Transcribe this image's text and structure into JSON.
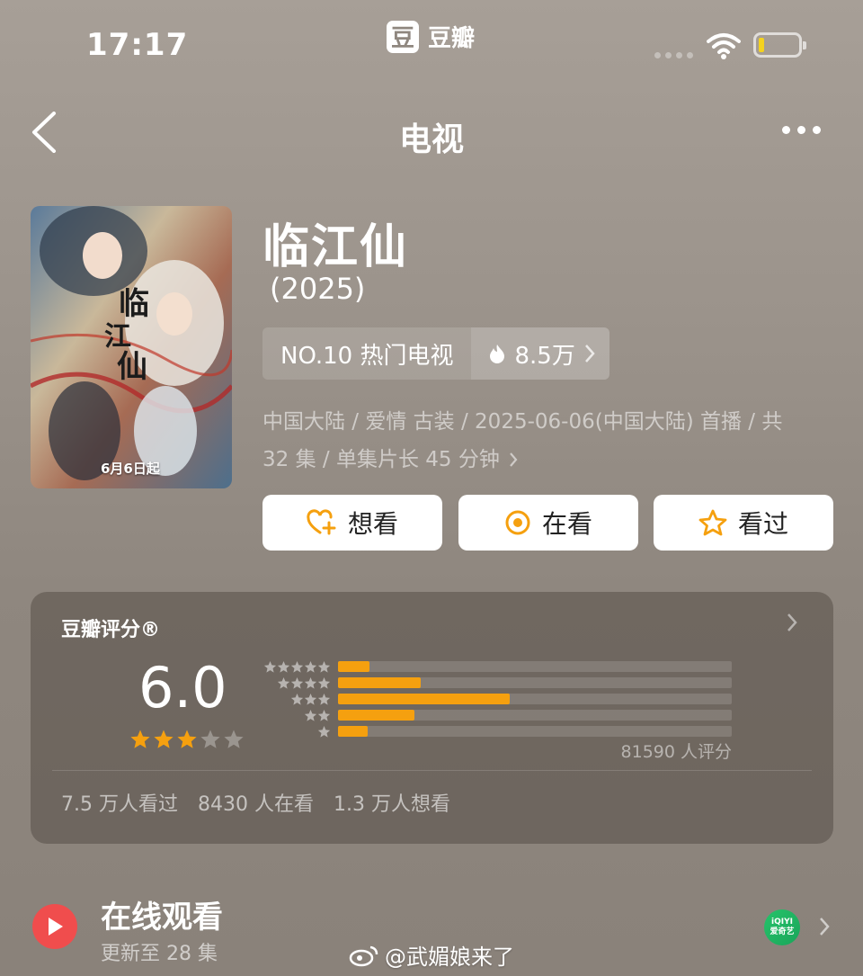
{
  "status_bar": {
    "time": "17:17",
    "brand_logo": "豆",
    "brand_name": "豆瓣"
  },
  "nav": {
    "title": "电视",
    "back_icon": "chevron-left-icon",
    "more_icon": "more-dots-icon"
  },
  "poster": {
    "label": "6月6日起"
  },
  "show": {
    "title": "临江仙",
    "year": "(2025)",
    "rank_label": "NO.10 热门电视",
    "heat": "8.5万",
    "meta_line1": "中国大陆 / 爱情 古装 / 2025-06-06(中国大陆) 首播 / 共",
    "meta_line2": "32 集 / 单集片长 45 分钟"
  },
  "actions": [
    {
      "label": "想看",
      "icon": "heart-plus-icon"
    },
    {
      "label": "在看",
      "icon": "watching-circle-icon"
    },
    {
      "label": "看过",
      "icon": "star-outline-icon"
    }
  ],
  "rating": {
    "header": "豆瓣评分®",
    "score": "6.0",
    "stars_filled": 3,
    "stars_total": 5,
    "distribution": [
      {
        "stars": 5,
        "fraction": 0.08
      },
      {
        "stars": 4,
        "fraction": 0.21
      },
      {
        "stars": 3,
        "fraction": 0.435
      },
      {
        "stars": 2,
        "fraction": 0.195
      },
      {
        "stars": 1,
        "fraction": 0.075
      }
    ],
    "count": "81590 人评分",
    "stats": [
      "7.5 万人看过",
      "8430 人在看",
      "1.3 万人想看"
    ]
  },
  "online": {
    "title": "在线观看",
    "subtitle": "更新至 28 集",
    "platform_logo_line1": "iQIYI",
    "platform_logo_line2": "爱奇艺"
  },
  "watermark": "@武媚娘来了",
  "colors": {
    "accent": "#f5a00f",
    "play": "#f04d4d",
    "rating_star": "#f5a00f"
  }
}
